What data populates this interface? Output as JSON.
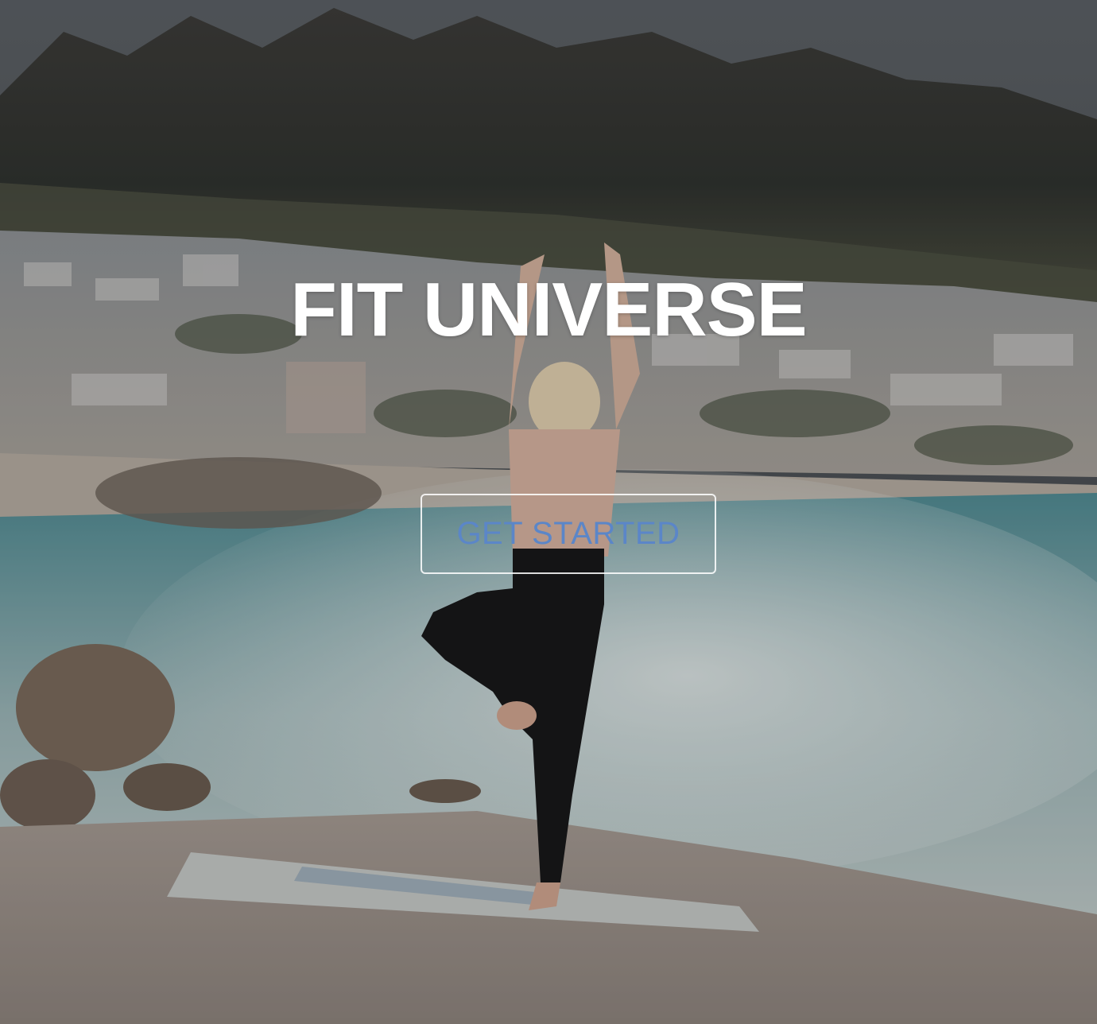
{
  "hero": {
    "title": "FIT UNIVERSE",
    "cta_label": "GET STARTED",
    "background_description_icon": "yoga-beach-photo"
  },
  "colors": {
    "title": "#ffffff",
    "cta_text": "#5b86c8",
    "cta_border": "#ffffff"
  }
}
